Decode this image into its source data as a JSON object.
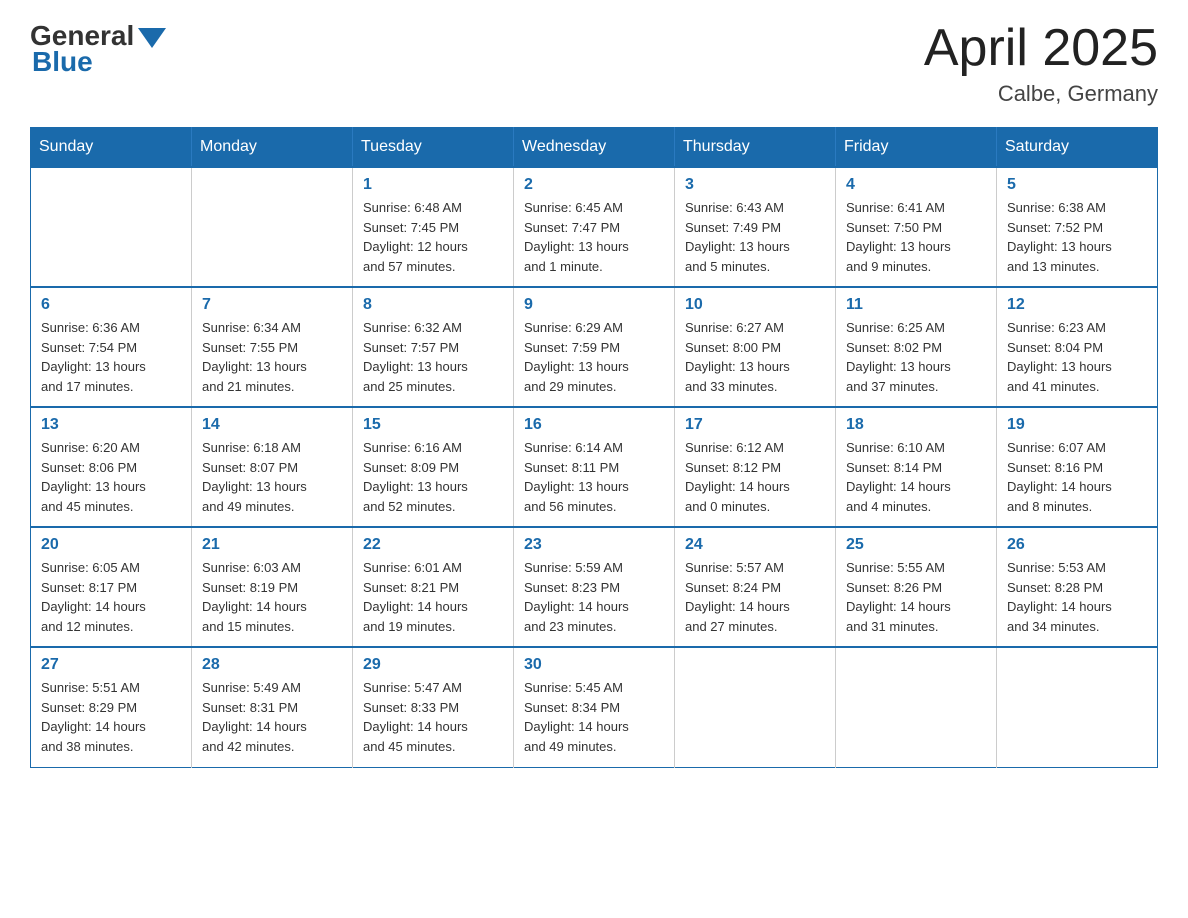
{
  "header": {
    "logo_general": "General",
    "logo_blue": "Blue",
    "month_year": "April 2025",
    "location": "Calbe, Germany"
  },
  "weekdays": [
    "Sunday",
    "Monday",
    "Tuesday",
    "Wednesday",
    "Thursday",
    "Friday",
    "Saturday"
  ],
  "weeks": [
    [
      {
        "day": "",
        "info": ""
      },
      {
        "day": "",
        "info": ""
      },
      {
        "day": "1",
        "info": "Sunrise: 6:48 AM\nSunset: 7:45 PM\nDaylight: 12 hours\nand 57 minutes."
      },
      {
        "day": "2",
        "info": "Sunrise: 6:45 AM\nSunset: 7:47 PM\nDaylight: 13 hours\nand 1 minute."
      },
      {
        "day": "3",
        "info": "Sunrise: 6:43 AM\nSunset: 7:49 PM\nDaylight: 13 hours\nand 5 minutes."
      },
      {
        "day": "4",
        "info": "Sunrise: 6:41 AM\nSunset: 7:50 PM\nDaylight: 13 hours\nand 9 minutes."
      },
      {
        "day": "5",
        "info": "Sunrise: 6:38 AM\nSunset: 7:52 PM\nDaylight: 13 hours\nand 13 minutes."
      }
    ],
    [
      {
        "day": "6",
        "info": "Sunrise: 6:36 AM\nSunset: 7:54 PM\nDaylight: 13 hours\nand 17 minutes."
      },
      {
        "day": "7",
        "info": "Sunrise: 6:34 AM\nSunset: 7:55 PM\nDaylight: 13 hours\nand 21 minutes."
      },
      {
        "day": "8",
        "info": "Sunrise: 6:32 AM\nSunset: 7:57 PM\nDaylight: 13 hours\nand 25 minutes."
      },
      {
        "day": "9",
        "info": "Sunrise: 6:29 AM\nSunset: 7:59 PM\nDaylight: 13 hours\nand 29 minutes."
      },
      {
        "day": "10",
        "info": "Sunrise: 6:27 AM\nSunset: 8:00 PM\nDaylight: 13 hours\nand 33 minutes."
      },
      {
        "day": "11",
        "info": "Sunrise: 6:25 AM\nSunset: 8:02 PM\nDaylight: 13 hours\nand 37 minutes."
      },
      {
        "day": "12",
        "info": "Sunrise: 6:23 AM\nSunset: 8:04 PM\nDaylight: 13 hours\nand 41 minutes."
      }
    ],
    [
      {
        "day": "13",
        "info": "Sunrise: 6:20 AM\nSunset: 8:06 PM\nDaylight: 13 hours\nand 45 minutes."
      },
      {
        "day": "14",
        "info": "Sunrise: 6:18 AM\nSunset: 8:07 PM\nDaylight: 13 hours\nand 49 minutes."
      },
      {
        "day": "15",
        "info": "Sunrise: 6:16 AM\nSunset: 8:09 PM\nDaylight: 13 hours\nand 52 minutes."
      },
      {
        "day": "16",
        "info": "Sunrise: 6:14 AM\nSunset: 8:11 PM\nDaylight: 13 hours\nand 56 minutes."
      },
      {
        "day": "17",
        "info": "Sunrise: 6:12 AM\nSunset: 8:12 PM\nDaylight: 14 hours\nand 0 minutes."
      },
      {
        "day": "18",
        "info": "Sunrise: 6:10 AM\nSunset: 8:14 PM\nDaylight: 14 hours\nand 4 minutes."
      },
      {
        "day": "19",
        "info": "Sunrise: 6:07 AM\nSunset: 8:16 PM\nDaylight: 14 hours\nand 8 minutes."
      }
    ],
    [
      {
        "day": "20",
        "info": "Sunrise: 6:05 AM\nSunset: 8:17 PM\nDaylight: 14 hours\nand 12 minutes."
      },
      {
        "day": "21",
        "info": "Sunrise: 6:03 AM\nSunset: 8:19 PM\nDaylight: 14 hours\nand 15 minutes."
      },
      {
        "day": "22",
        "info": "Sunrise: 6:01 AM\nSunset: 8:21 PM\nDaylight: 14 hours\nand 19 minutes."
      },
      {
        "day": "23",
        "info": "Sunrise: 5:59 AM\nSunset: 8:23 PM\nDaylight: 14 hours\nand 23 minutes."
      },
      {
        "day": "24",
        "info": "Sunrise: 5:57 AM\nSunset: 8:24 PM\nDaylight: 14 hours\nand 27 minutes."
      },
      {
        "day": "25",
        "info": "Sunrise: 5:55 AM\nSunset: 8:26 PM\nDaylight: 14 hours\nand 31 minutes."
      },
      {
        "day": "26",
        "info": "Sunrise: 5:53 AM\nSunset: 8:28 PM\nDaylight: 14 hours\nand 34 minutes."
      }
    ],
    [
      {
        "day": "27",
        "info": "Sunrise: 5:51 AM\nSunset: 8:29 PM\nDaylight: 14 hours\nand 38 minutes."
      },
      {
        "day": "28",
        "info": "Sunrise: 5:49 AM\nSunset: 8:31 PM\nDaylight: 14 hours\nand 42 minutes."
      },
      {
        "day": "29",
        "info": "Sunrise: 5:47 AM\nSunset: 8:33 PM\nDaylight: 14 hours\nand 45 minutes."
      },
      {
        "day": "30",
        "info": "Sunrise: 5:45 AM\nSunset: 8:34 PM\nDaylight: 14 hours\nand 49 minutes."
      },
      {
        "day": "",
        "info": ""
      },
      {
        "day": "",
        "info": ""
      },
      {
        "day": "",
        "info": ""
      }
    ]
  ]
}
